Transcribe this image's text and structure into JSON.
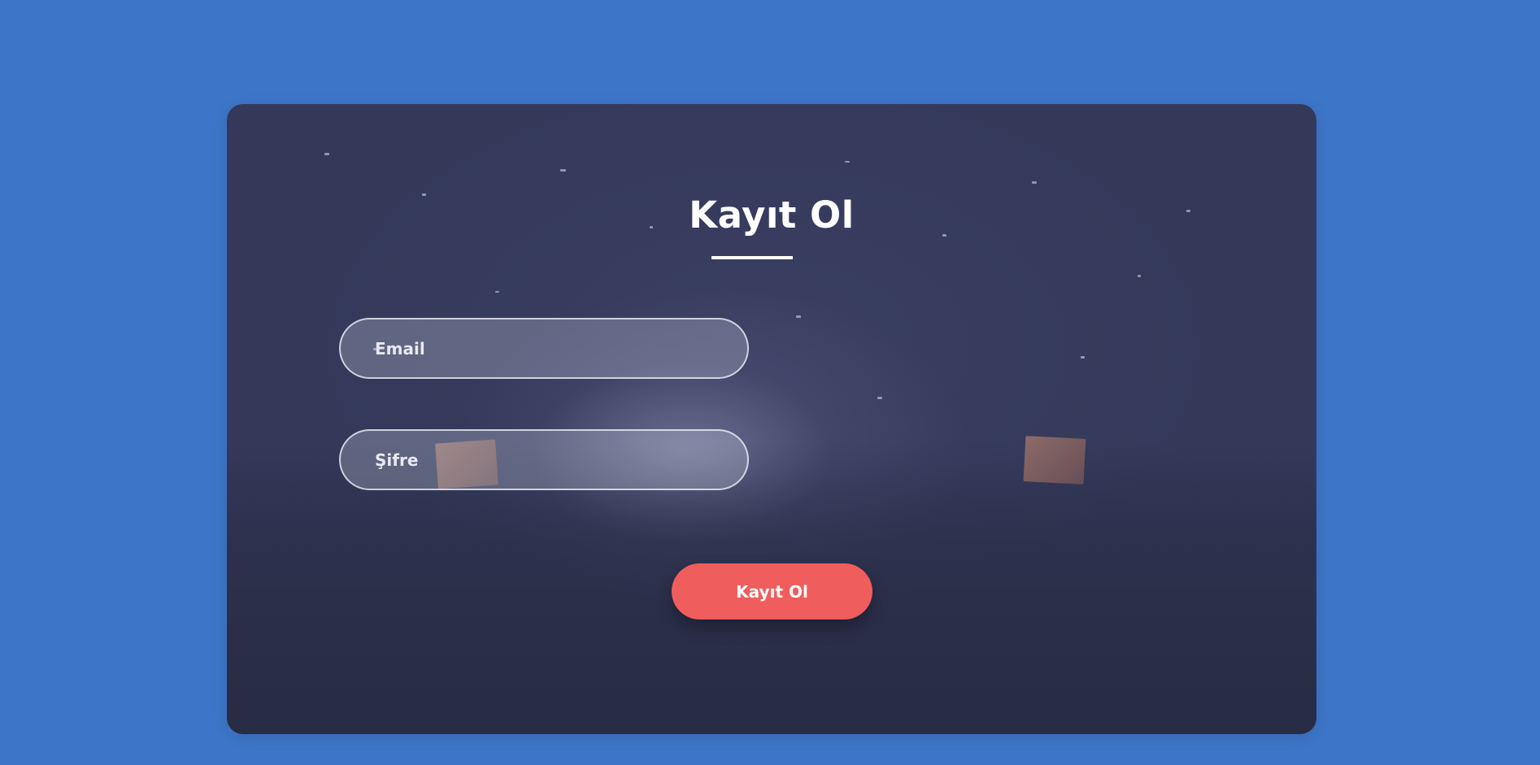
{
  "form": {
    "title": "Kayıt Ol",
    "email_placeholder": "Email",
    "password_placeholder": "Şifre",
    "submit_label": "Kayıt Ol"
  },
  "colors": {
    "page_background": "#3d76c8",
    "card_background": "#34395a",
    "submit_button": "#f05d5d",
    "text": "#ffffff"
  }
}
